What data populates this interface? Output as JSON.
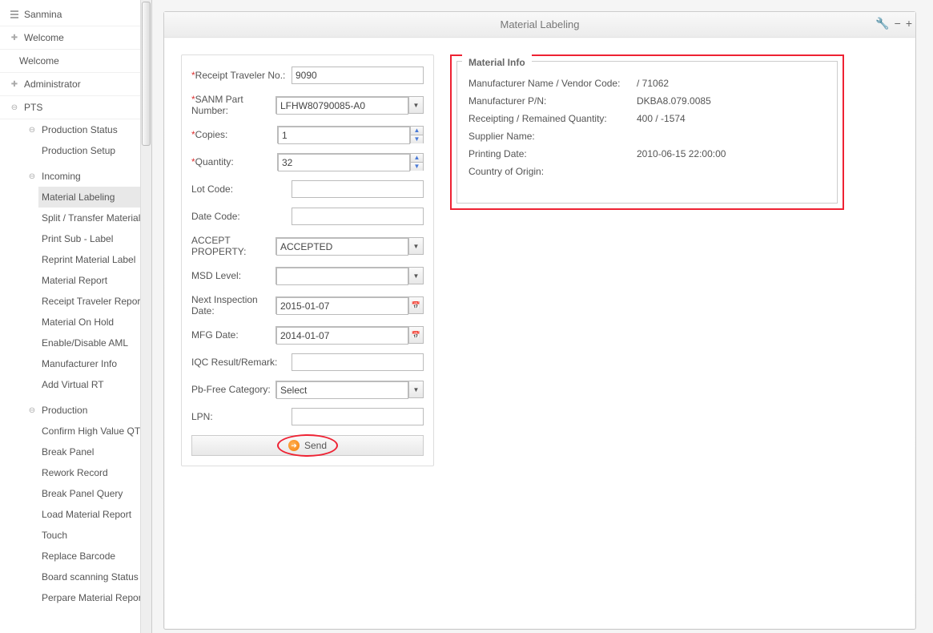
{
  "sidebar": {
    "root": "Sanmina",
    "welcome1": "Welcome",
    "welcome2": "Welcome",
    "admin": "Administrator",
    "pts": "PTS",
    "prodStatus": "Production Status",
    "prodSetup": "Production Setup",
    "incoming": "Incoming",
    "incomingItems": [
      "Material Labeling",
      "Split / Transfer Material",
      "Print Sub - Label",
      "Reprint Material Label",
      "Material Report",
      "Receipt Traveler Report",
      "Material On Hold",
      "Enable/Disable AML",
      "Manufacturer Info",
      "Add Virtual RT"
    ],
    "production": "Production",
    "productionItems": [
      "Confirm High Value QTY",
      "Break Panel",
      "Rework Record",
      "Break Panel Query",
      "Load Material Report",
      "Touch",
      "Replace Barcode",
      "Board scanning Status",
      "Perpare Material Report"
    ]
  },
  "header": {
    "title": "Material Labeling"
  },
  "form": {
    "receiptTravelerLabel": "Receipt Traveler No.:",
    "receiptTravelerValue": "9090",
    "sanmPartLabel": "SANM Part Number:",
    "sanmPartValue": "LFHW80790085-A0",
    "copiesLabel": "Copies:",
    "copiesValue": "1",
    "quantityLabel": "Quantity:",
    "quantityValue": "32",
    "lotCodeLabel": "Lot Code:",
    "lotCodeValue": "",
    "dateCodeLabel": "Date Code:",
    "dateCodeValue": "",
    "acceptPropLabel": "ACCEPT PROPERTY:",
    "acceptPropValue": "ACCEPTED",
    "msdLevelLabel": "MSD Level:",
    "msdLevelValue": "",
    "nextInspLabel": "Next Inspection Date:",
    "nextInspValue": "2015-01-07",
    "mfgDateLabel": "MFG Date:",
    "mfgDateValue": "2014-01-07",
    "iqcLabel": "IQC Result/Remark:",
    "iqcValue": "",
    "pbFreeLabel": "Pb-Free Category:",
    "pbFreeValue": "Select",
    "lpnLabel": "LPN:",
    "lpnValue": "",
    "sendLabel": "Send"
  },
  "info": {
    "title": "Material Info",
    "rows": [
      {
        "label": "Manufacturer Name / Vendor Code:",
        "value": "/ 71062"
      },
      {
        "label": "Manufacturer P/N:",
        "value": "DKBA8.079.0085"
      },
      {
        "label": "Receipting / Remained Quantity:",
        "value": "400 / -1574"
      },
      {
        "label": "Supplier Name:",
        "value": ""
      },
      {
        "label": "Printing Date:",
        "value": "2010-06-15 22:00:00"
      },
      {
        "label": "Country of Origin:",
        "value": ""
      }
    ]
  }
}
